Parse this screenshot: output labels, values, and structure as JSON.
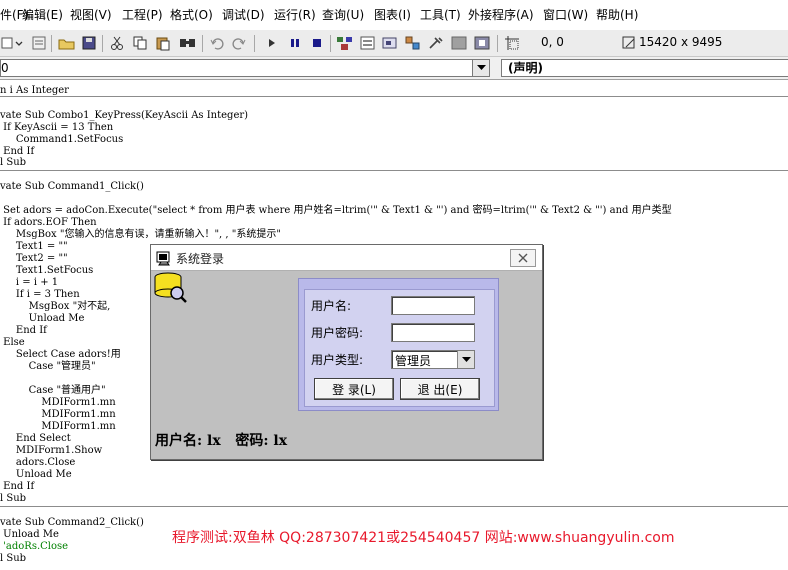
{
  "menu": [
    {
      "label": "件(F)"
    },
    {
      "label": "编辑(E)"
    },
    {
      "label": "视图(V)"
    },
    {
      "label": "工程(P)"
    },
    {
      "label": "格式(O)"
    },
    {
      "label": "调试(D)"
    },
    {
      "label": "运行(R)"
    },
    {
      "label": "查询(U)"
    },
    {
      "label": "图表(I)"
    },
    {
      "label": "工具(T)"
    },
    {
      "label": "外接程序(A)"
    },
    {
      "label": "窗口(W)"
    },
    {
      "label": "帮助(H)"
    }
  ],
  "toolbar": {
    "position_readout": "0, 0",
    "size_readout": "15420 x 9495"
  },
  "editor": {
    "object_combo": "0",
    "procedure_combo": "(声明)"
  },
  "code_lines": [
    "n i As Integer",
    "vate Sub Combo1_KeyPress(KeyAscii As Integer)",
    " If KeyAscii = 13 Then",
    "     Command1.SetFocus",
    " End If",
    "l Sub",
    "vate Sub Command1_Click()",
    " Set adors = adoCon.Execute(\"select * from 用户表 where 用户姓名=ltrim('\" & Text1 & \"') and 密码=ltrim('\" & Text2 & \"') and 用户类型",
    " If adors.EOF Then",
    "     MsgBox \"您输入的信息有误，请重新输入！\", , \"系统提示\"",
    "     Text1 = \"\"",
    "     Text2 = \"\"",
    "     Text1.SetFocus",
    "     i = i + 1",
    "     If i = 3 Then",
    "         MsgBox \"对不起,",
    "         Unload Me",
    "     End If",
    " Else",
    "     Select Case adors!用",
    "         Case \"管理员\"",
    "         Case \"普通用户\"",
    "             MDIForm1.mn",
    "             MDIForm1.mn",
    "             MDIForm1.mn",
    "     End Select",
    "     MDIForm1.Show",
    "     adors.Close",
    "     Unload Me",
    " End If",
    "l Sub",
    "vate Sub Command2_Click()",
    " Unload Me",
    " 'adoRs.Close",
    "l Sub"
  ],
  "watermark": "程序测试:双鱼林 QQ:287307421或254540457 网站:www.shuangyulin.com",
  "dialog": {
    "title": "系统登录",
    "username_label": "用户名:",
    "password_label": "用户密码:",
    "usertype_label": "用户类型:",
    "usertype_value": "管理员",
    "username_value": "",
    "password_value": "",
    "login_button": "登 录(L)",
    "exit_button": "退 出(E)",
    "status_text": "用户名: lx   密码: lx"
  },
  "colors": {
    "watermark": "#e8192c",
    "dialog_panel": "#b9b9ea",
    "dialog_bg": "#c0c0c0",
    "comment": "#008000"
  }
}
